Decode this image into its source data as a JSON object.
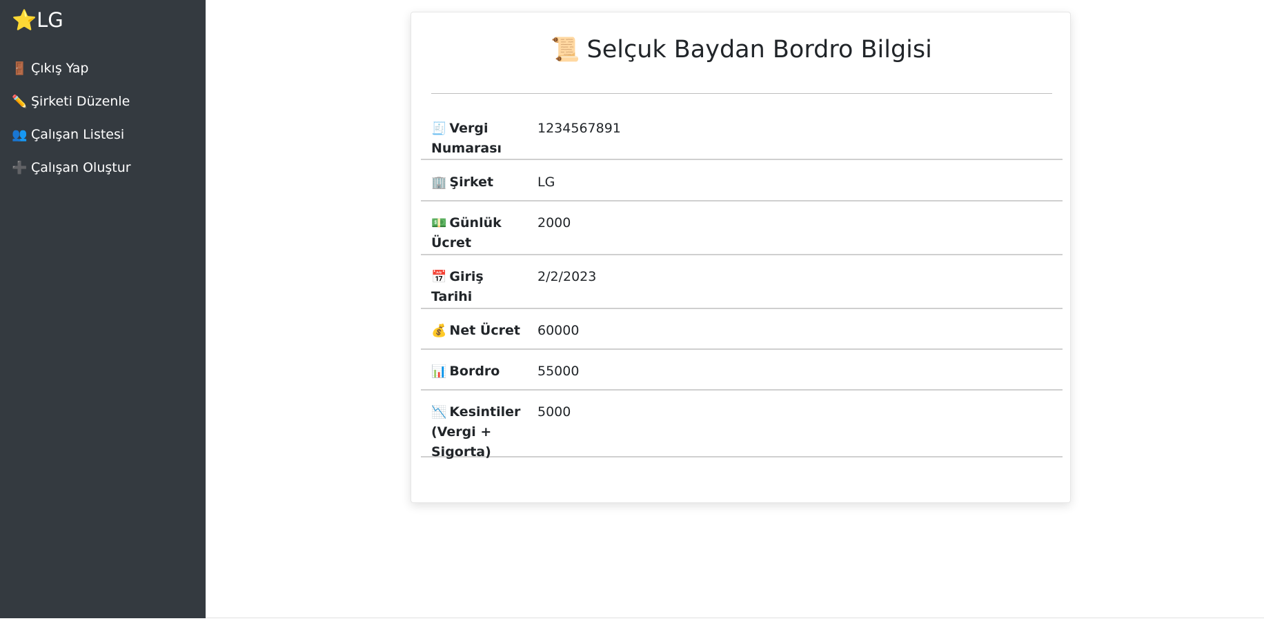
{
  "sidebar": {
    "brand": {
      "icon": "star-icon",
      "label": "LG"
    },
    "items": [
      {
        "icon": "door-icon",
        "label": "Çıkış Yap"
      },
      {
        "icon": "pencil-icon",
        "label": "Şirketi Düzenle"
      },
      {
        "icon": "people-icon",
        "label": "Çalışan Listesi"
      },
      {
        "icon": "plus-icon",
        "label": "Çalışan Oluştur"
      }
    ]
  },
  "card": {
    "title_icon": "scroll-icon",
    "title": "Selçuk Baydan Bordro Bilgisi",
    "rows": [
      {
        "icon": "receipt-icon",
        "label": "Vergi Numarası",
        "value": "1234567891"
      },
      {
        "icon": "office-building-icon",
        "label": "Şirket",
        "value": "LG"
      },
      {
        "icon": "banknote-icon",
        "label": "Günlük Ücret",
        "value": "2000"
      },
      {
        "icon": "calendar-icon",
        "label": "Giriş Tarihi",
        "value": "2/2/2023"
      },
      {
        "icon": "money-bag-icon",
        "label": "Net Ücret",
        "value": "60000"
      },
      {
        "icon": "bar-chart-icon",
        "label": "Bordro",
        "value": "55000"
      },
      {
        "icon": "chart-decreasing-icon",
        "label": "Kesintiler (Vergi + Sigorta)",
        "value": "5000"
      }
    ]
  },
  "colors": {
    "sidebar_bg": "#343a40",
    "text": "#212529",
    "accent_star": "#f5c518"
  }
}
